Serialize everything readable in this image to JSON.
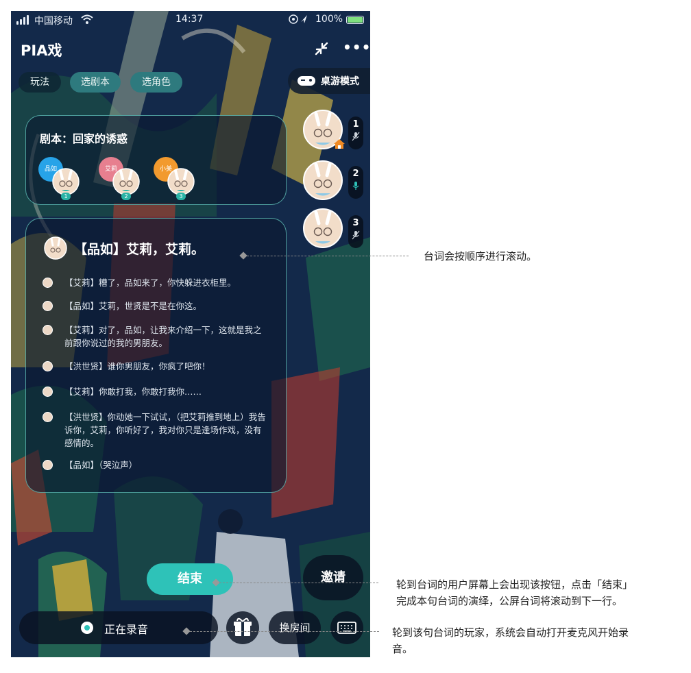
{
  "status_bar": {
    "carrier": "中国移动",
    "time": "14:37",
    "battery": "100%"
  },
  "header": {
    "title": "PIA戏",
    "more_label": "•••"
  },
  "chips": [
    {
      "label": "玩法",
      "highlighted": false
    },
    {
      "label": "选剧本",
      "highlighted": true
    },
    {
      "label": "选角色",
      "highlighted": true
    }
  ],
  "game_mode_label": "桌游模式",
  "script": {
    "title": "剧本：回家的诱惑",
    "roles": [
      {
        "name": "品如",
        "number": "1",
        "color": "#27a3e8"
      },
      {
        "name": "艾莉",
        "number": "2",
        "color": "#e77f8f"
      },
      {
        "name": "小美",
        "number": "3",
        "color": "#f29a2e"
      }
    ]
  },
  "lines": {
    "current": "【品如】艾莉，艾莉。",
    "items": [
      "【艾莉】糟了，品如来了，你快躲进衣柜里。",
      "【品如】艾莉，世贤是不是在你这。",
      "【艾莉】对了，品如，让我来介绍一下，这就是我之前跟你说过的我的男朋友。",
      "【洪世贤】谁你男朋友，你疯了吧你！",
      "【艾莉】你敢打我，你敢打我你……",
      "【洪世贤】你动她一下试试，（把艾莉推到地上）我告诉你，艾莉，你听好了，我对你只是逢场作戏，没有感情的。",
      "【品如】（哭泣声）"
    ]
  },
  "seats": [
    {
      "number": "1",
      "mic": "muted",
      "owner": true
    },
    {
      "number": "2",
      "mic": "active",
      "owner": false
    },
    {
      "number": "3",
      "mic": "muted",
      "owner": false
    }
  ],
  "buttons": {
    "end": "结束",
    "invite": "邀请",
    "recording": "正在录音",
    "swap_room": "换房间"
  },
  "annotations": {
    "scroll_note": "台词会按顺序进行滚动。",
    "end_note_line1": "轮到台词的用户屏幕上会出现该按钮，点击「结束」",
    "end_note_line2": "完成本句台词的演绎，公屏台词将滚动到下一行。",
    "rec_note_line1": "轮到该句台词的玩家，系统会自动打开麦克风开始录",
    "rec_note_line2": "音。"
  },
  "colors": {
    "accent": "#2ec2b8",
    "panel_border": "#69d2c8",
    "background": "#142a4a"
  }
}
